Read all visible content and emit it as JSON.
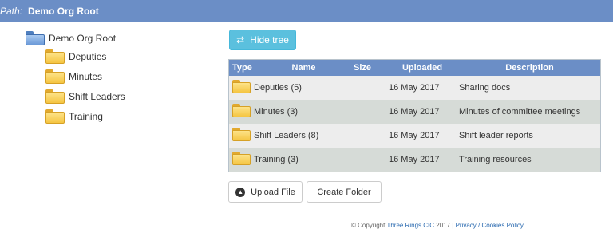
{
  "path": {
    "label": "Path:",
    "value": "Demo Org Root"
  },
  "tree": {
    "root": {
      "label": "Demo Org Root",
      "icon": "folder-open-icon"
    },
    "children": [
      {
        "label": "Deputies",
        "icon": "folder-icon"
      },
      {
        "label": "Minutes",
        "icon": "folder-icon"
      },
      {
        "label": "Shift Leaders",
        "icon": "folder-icon"
      },
      {
        "label": "Training",
        "icon": "folder-icon"
      }
    ]
  },
  "toolbar": {
    "hide_tree_label": "Hide tree",
    "hide_tree_icon": "swap-arrows-icon"
  },
  "table": {
    "headers": {
      "type": "Type",
      "name": "Name",
      "size": "Size",
      "uploaded": "Uploaded",
      "description": "Description"
    },
    "rows": [
      {
        "name": "Deputies (5)",
        "size": "",
        "uploaded": "16 May 2017",
        "description": "Sharing docs"
      },
      {
        "name": "Minutes (3)",
        "size": "",
        "uploaded": "16 May 2017",
        "description": "Minutes of committee meetings"
      },
      {
        "name": "Shift Leaders (8)",
        "size": "",
        "uploaded": "16 May 2017",
        "description": "Shift leader reports"
      },
      {
        "name": "Training (3)",
        "size": "",
        "uploaded": "16 May 2017",
        "description": "Training resources"
      }
    ]
  },
  "actions": {
    "upload_label": "Upload File",
    "upload_icon": "upload-circle-icon",
    "create_folder_label": "Create Folder"
  },
  "footer": {
    "prefix": "© Copyright ",
    "org_link": "Three Rings CIC",
    "year_sep": " 2017 | ",
    "policy_link": "Privacy / Cookies Policy"
  },
  "colors": {
    "header_blue": "#6b8ec6",
    "info_button": "#5bc0de",
    "folder_yellow": "#f5c542"
  }
}
